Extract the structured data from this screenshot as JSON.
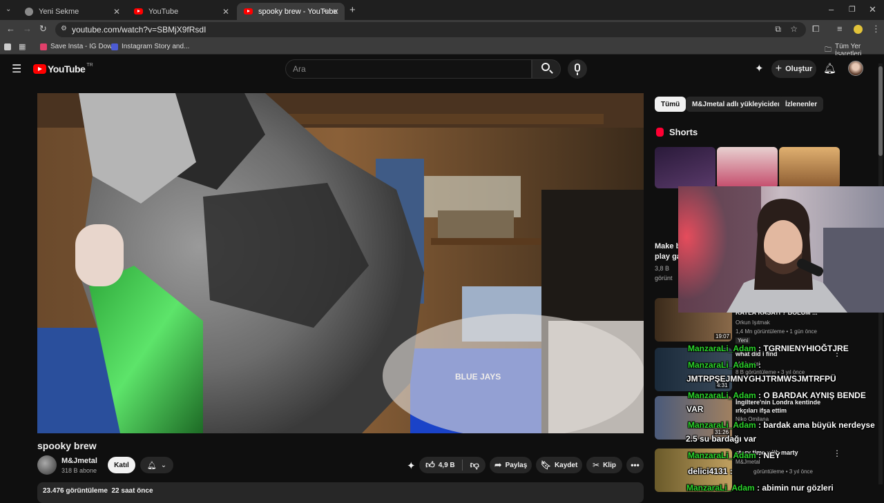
{
  "browser": {
    "tabs": [
      {
        "label": "Yeni Sekme"
      },
      {
        "label": "YouTube"
      },
      {
        "label": "spooky brew - YouTube"
      }
    ],
    "url": "youtube.com/watch?v=SBMjX9fRsdI",
    "bookmarks": [
      {
        "label": "Save Insta - IG Dow..."
      },
      {
        "label": "Instagram Story and..."
      }
    ],
    "all_bookmarks": "Tüm Yer İşaretleri"
  },
  "header": {
    "logo": "YouTube",
    "region": "TR",
    "search_placeholder": "Ara",
    "create_label": "Oluştur"
  },
  "video": {
    "title": "spooky brew",
    "channel": "M&Jmetal",
    "subscribers": "318 B abone",
    "join_label": "Katıl",
    "likes": "4,9 B",
    "share_label": "Paylaş",
    "save_label": "Kaydet",
    "clip_label": "Klip",
    "views": "23.476 görüntüleme",
    "age": "22 saat önce"
  },
  "sidebar": {
    "chips": [
      "Tümü",
      "M&Jmetal adlı yükleyiciden",
      "İzlenenler"
    ],
    "shorts_title": "Shorts",
    "short_label": "Make b",
    "short_label2": "play ga",
    "short_views": "3,8 B",
    "short_views2": "görünt",
    "recs": [
      {
        "title": "KAYLA KASATI ? BÖLÜM ...",
        "channel": "Orkun Işıtmak",
        "meta": "1,4 Mn görüntüleme • 1 gün önce",
        "duration": "19:07",
        "badge": "Yeni"
      },
      {
        "title": "what did i find",
        "channel": "M&Jmetal",
        "meta": "8 B görüntüleme • 3 yıl önce",
        "duration": "4:31"
      },
      {
        "title": "İngiltere'nin Londra kentinde ırkçıları ifşa ettim",
        "channel": "Niko Omilana",
        "meta": "",
        "duration": "31:26"
      },
      {
        "title": "story time with marty",
        "channel": "M&Jmetal",
        "meta": "görüntüleme • 3 yıl önce",
        "duration": ""
      }
    ]
  },
  "chat": [
    {
      "user": "ManzaraLi_Adam",
      "text": " : TGRNIENYHIOĞTJRE",
      "cont": ""
    },
    {
      "user": "ManzaraLi_Adam",
      "text": " :",
      "cont": "JMTRPŞEJMNYGHJTRMWSJMTRFPÜ"
    },
    {
      "user": "ManzaraLi_Adam",
      "text": " : O BARDAK AYNIŞ BENDE",
      "cont": "VAR"
    },
    {
      "user": "ManzaraLi_Adam",
      "text": " : bardak ama büyük nerdeyse",
      "cont": "2.5 su bardağı var"
    },
    {
      "user": "ManzaraLi_Adam",
      "text": " : NEY",
      "cont": ""
    },
    {
      "user": "delici4131",
      "text": " :",
      "cont": ""
    },
    {
      "user": "ManzaraLi_Adam",
      "text": " : abimin nur gözleri",
      "cont": ""
    }
  ]
}
